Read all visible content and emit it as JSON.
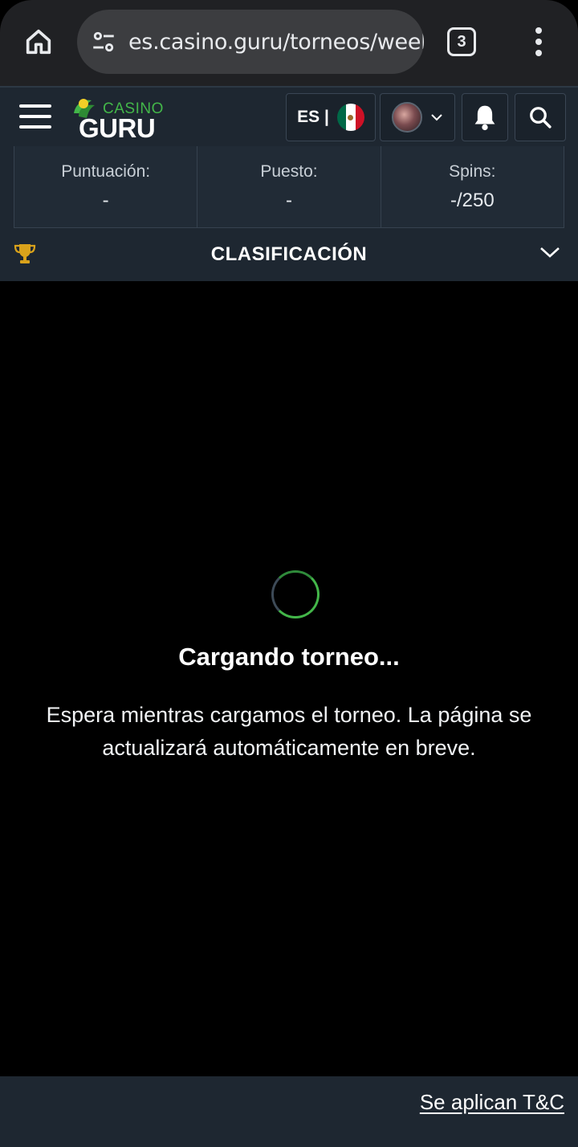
{
  "browser": {
    "url": "es.casino.guru/torneos/weekly",
    "tab_count": "3"
  },
  "header": {
    "logo_top": "CASINO",
    "logo_bottom": "GURU",
    "language": "ES |",
    "flag_colors": [
      "#006847",
      "#ffffff",
      "#ce1126"
    ]
  },
  "stats": [
    {
      "label": "Puntuación:",
      "value": "-"
    },
    {
      "label": "Puesto:",
      "value": "-"
    },
    {
      "label": "Spins:",
      "value": "-/250"
    }
  ],
  "leaderboard": {
    "title": "CLASIFICACIÓN"
  },
  "loading": {
    "title": "Cargando torneo...",
    "message": "Espera mientras cargamos el torneo. La página se actualizará automáticamente en breve."
  },
  "footer": {
    "terms_link": "Se aplican T&C"
  },
  "colors": {
    "accent_green": "#43b649",
    "header_bg": "#1e2731",
    "trophy_gold": "#d9a21b"
  }
}
